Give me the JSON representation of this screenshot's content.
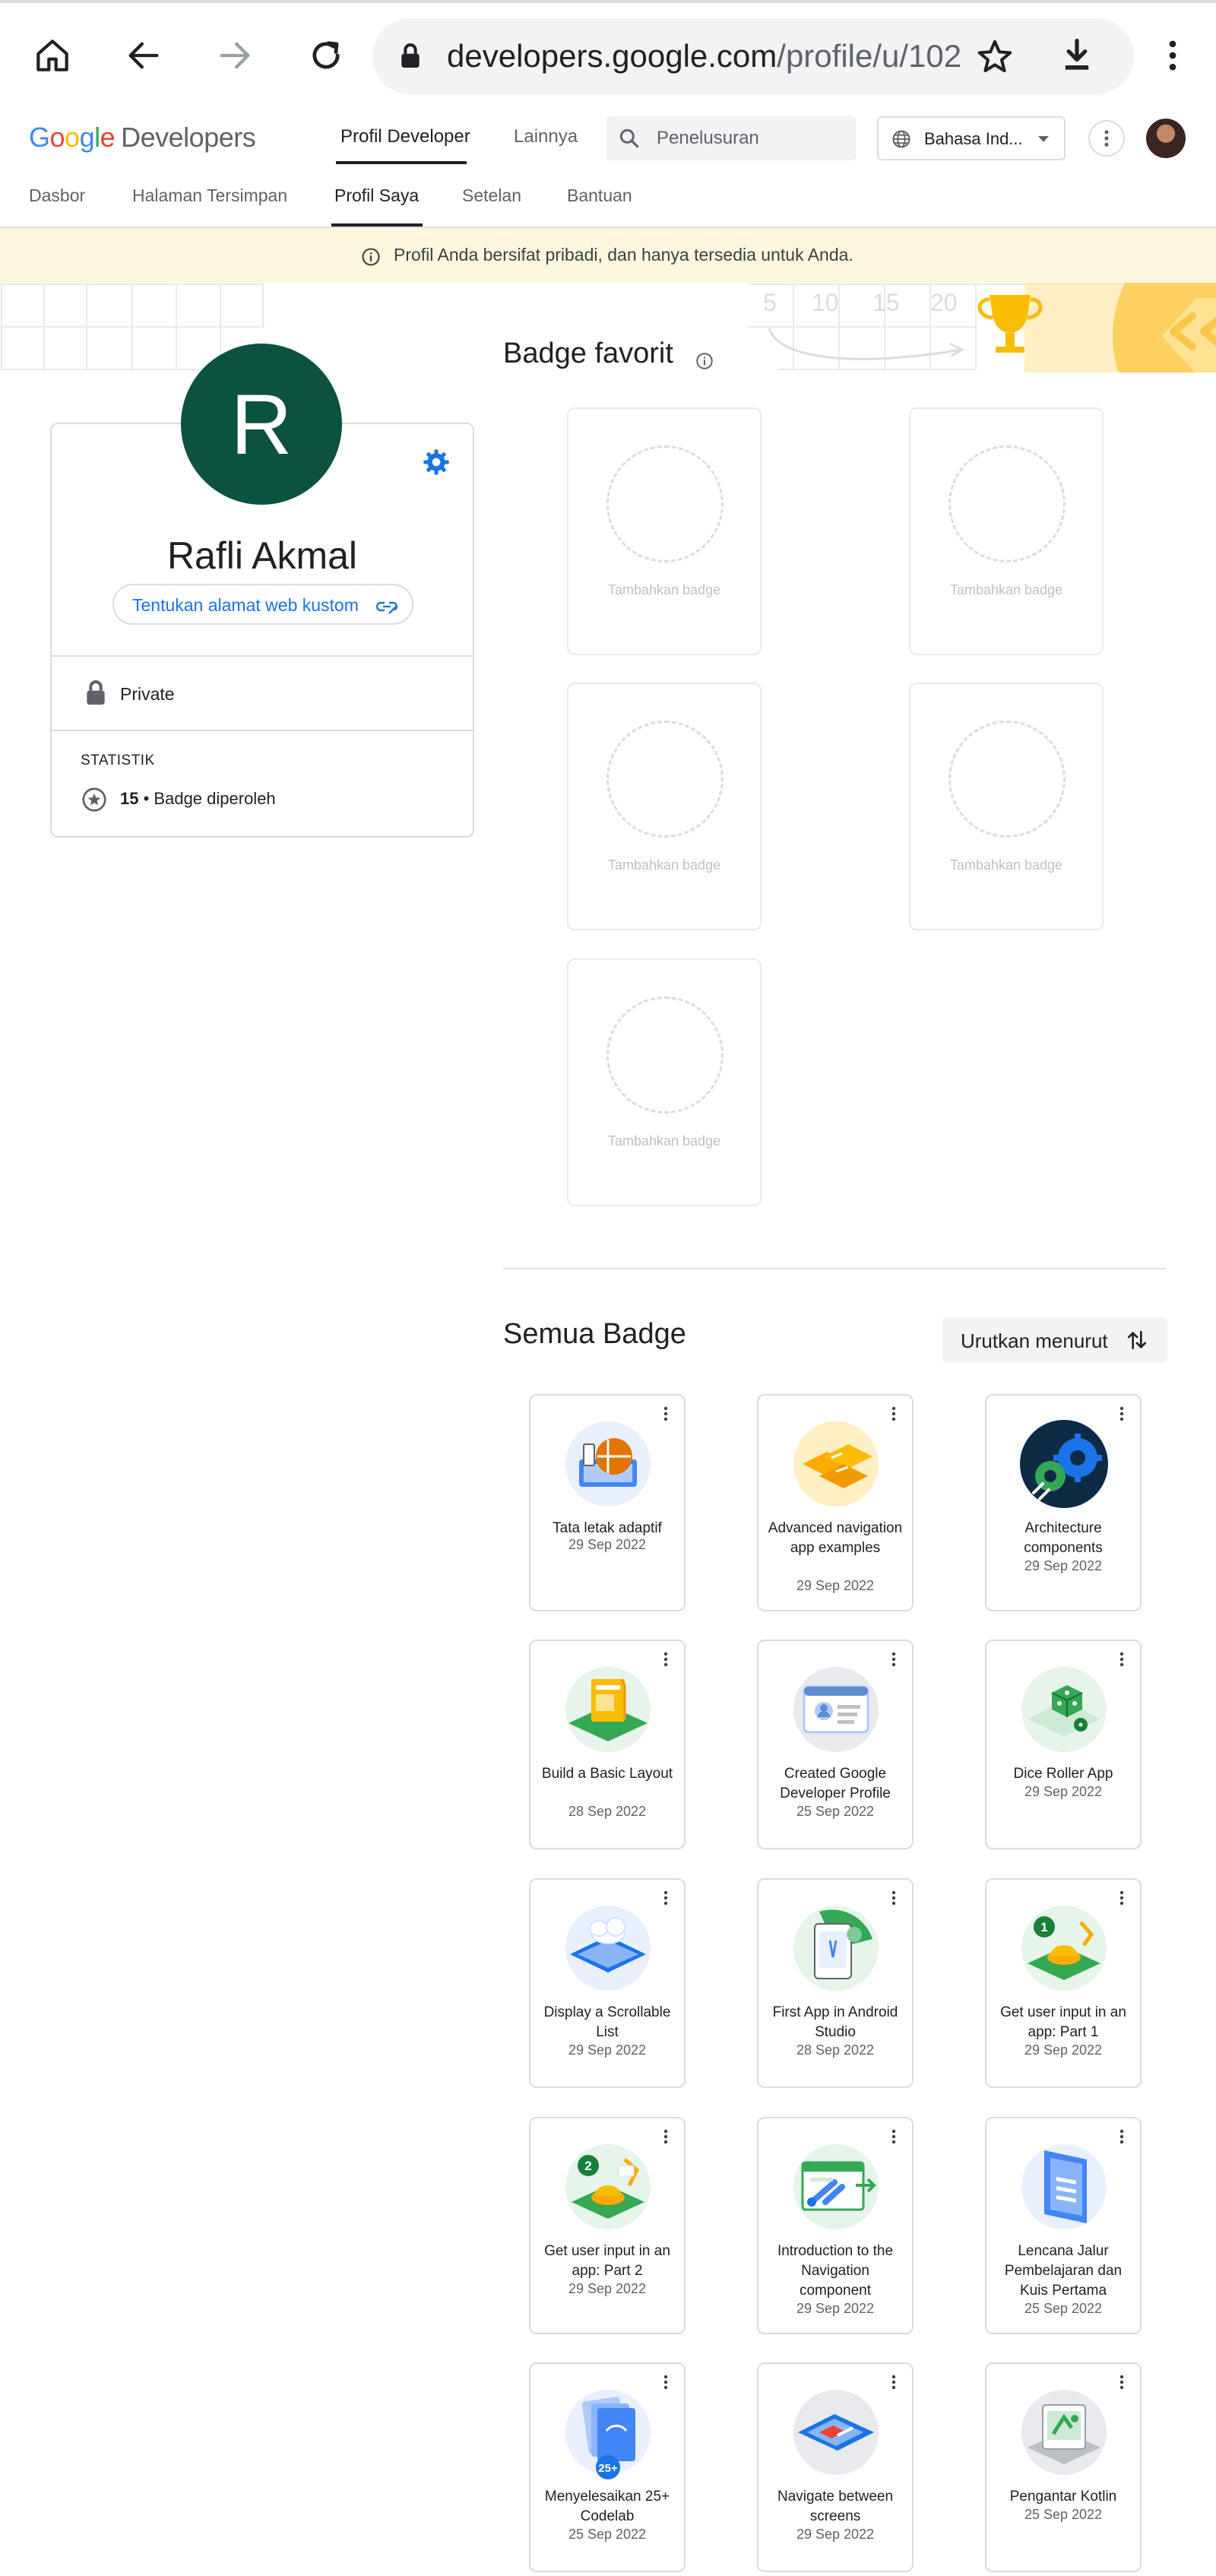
{
  "browser": {
    "url_host": "developers.google.com",
    "url_path": "/profile/u/102"
  },
  "header": {
    "logo_google": [
      "G",
      "o",
      "o",
      "g",
      "l",
      "e"
    ],
    "logo_developers": "Developers",
    "nav": [
      {
        "label": "Profil Developer",
        "active": true
      },
      {
        "label": "Lainnya",
        "active": false
      }
    ],
    "search_placeholder": "Penelusuran",
    "language": "Bahasa Ind..."
  },
  "subnav": [
    {
      "label": "Dasbor",
      "active": false
    },
    {
      "label": "Halaman Tersimpan",
      "active": false
    },
    {
      "label": "Profil Saya",
      "active": true
    },
    {
      "label": "Setelan",
      "active": false
    },
    {
      "label": "Bantuan",
      "active": false
    }
  ],
  "banner": {
    "text": "Profil Anda bersifat pribadi, dan hanya tersedia untuk Anda."
  },
  "hero": {
    "scale_numbers": [
      "5",
      "10",
      "15",
      "20"
    ]
  },
  "profile": {
    "initial": "R",
    "name": "Rafli Akmal",
    "custom_url_label": "Tentukan alamat web kustom",
    "privacy": "Private",
    "stats_title": "STATISTIK",
    "badge_count": "15",
    "badge_count_label": "• Badge diperoleh"
  },
  "favorites": {
    "title": "Badge favorit",
    "slots": [
      {
        "label": "Tambahkan badge"
      },
      {
        "label": "Tambahkan badge"
      },
      {
        "label": "Tambahkan badge"
      },
      {
        "label": "Tambahkan badge"
      },
      {
        "label": "Tambahkan badge"
      }
    ]
  },
  "all_badges": {
    "title": "Semua Badge",
    "sort_label": "Urutkan menurut",
    "items": [
      {
        "name": "Tata letak adaptif",
        "date": "29 Sep 2022",
        "icon": "adaptive-layout-icon",
        "color": "#4285f4"
      },
      {
        "name": "Advanced navigation app examples",
        "date": "29 Sep 2022",
        "icon": "navigation-examples-icon",
        "color": "#f9ab00"
      },
      {
        "name": "Architecture components",
        "date": "29 Sep 2022",
        "icon": "architecture-gears-icon",
        "color": "#1a73e8"
      },
      {
        "name": "Build a Basic Layout",
        "date": "28 Sep 2022",
        "icon": "basic-layout-icon",
        "color": "#34a853"
      },
      {
        "name": "Created Google Developer Profile",
        "date": "25 Sep 2022",
        "icon": "developer-profile-icon",
        "color": "#5f8dd3"
      },
      {
        "name": "Dice Roller App",
        "date": "29 Sep 2022",
        "icon": "dice-roller-icon",
        "color": "#34a853"
      },
      {
        "name": "Display a Scrollable List",
        "date": "29 Sep 2022",
        "icon": "scrollable-list-icon",
        "color": "#4285f4"
      },
      {
        "name": "First App in Android Studio",
        "date": "28 Sep 2022",
        "icon": "first-app-icon",
        "color": "#34a853"
      },
      {
        "name": "Get user input in an app: Part 1",
        "date": "29 Sep 2022",
        "icon": "user-input-part1-icon",
        "color": "#34a853",
        "step": "1"
      },
      {
        "name": "Get user input in an app: Part 2",
        "date": "29 Sep 2022",
        "icon": "user-input-part2-icon",
        "color": "#34a853",
        "step": "2"
      },
      {
        "name": "Introduction to the Navigation component",
        "date": "29 Sep 2022",
        "icon": "navigation-component-icon",
        "color": "#34a853"
      },
      {
        "name": "Lencana Jalur Pembelajaran dan Kuis Pertama",
        "date": "25 Sep 2022",
        "icon": "learning-path-icon",
        "color": "#4285f4"
      },
      {
        "name": "Menyelesaikan 25+ Codelab",
        "date": "25 Sep 2022",
        "icon": "codelab-25-icon",
        "color": "#1a73e8",
        "step": "25+"
      },
      {
        "name": "Navigate between screens",
        "date": "29 Sep 2022",
        "icon": "navigate-screens-icon",
        "color": "#1a73e8"
      },
      {
        "name": "Pengantar Kotlin",
        "date": "25 Sep 2022",
        "icon": "kotlin-intro-icon",
        "color": "#34a853"
      }
    ]
  }
}
